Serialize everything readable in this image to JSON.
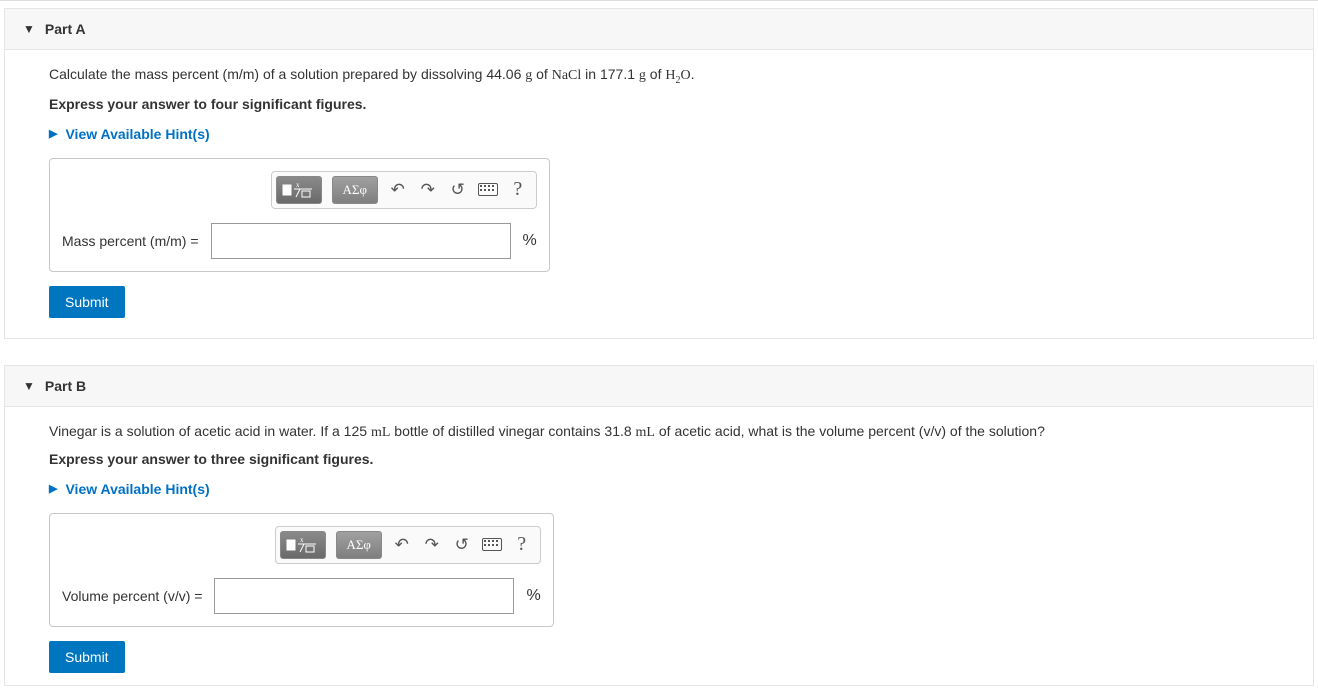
{
  "partA": {
    "title": "Part A",
    "question_pre": "Calculate the mass percent (m/m) of a solution prepared by dissolving 44.06 ",
    "q_unit1": "g",
    "q_of1": " of ",
    "chem1": "NaCl",
    "q_in": " in 177.1 ",
    "q_unit2": "g",
    "q_of2": " of ",
    "chem2_pre": "H",
    "chem2_sub": "2",
    "chem2_post": "O",
    "q_end": ".",
    "instruction": "Express your answer to four significant figures.",
    "hints_label": "View Available Hint(s)",
    "greek_label": "ΑΣφ",
    "input_label": "Mass percent (m/m) =",
    "unit": "%",
    "submit": "Submit",
    "help": "?"
  },
  "partB": {
    "title": "Part B",
    "question_pre": "Vinegar is a solution of acetic acid in water. If a 125 ",
    "unit1": "mL",
    "q_mid": " bottle of distilled vinegar contains 31.8 ",
    "unit2": "mL",
    "q_post": " of acetic acid, what is the volume percent (v/v) of the solution?",
    "instruction": "Express your answer to three significant figures.",
    "hints_label": "View Available Hint(s)",
    "greek_label": "ΑΣφ",
    "input_label": "Volume percent (v/v) =",
    "unit": "%",
    "submit": "Submit",
    "help": "?"
  }
}
